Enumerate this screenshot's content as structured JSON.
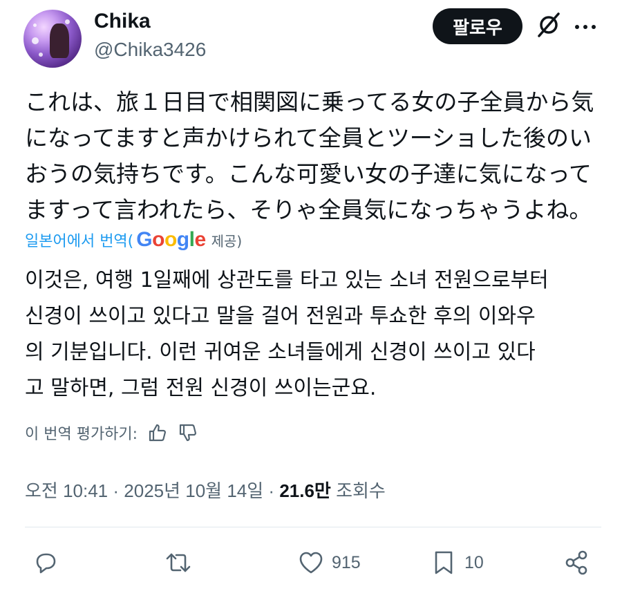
{
  "user": {
    "display_name": "Chika",
    "handle": "@Chika3426"
  },
  "header": {
    "follow_label": "팔로우"
  },
  "tweet": {
    "original_lines": [
      "これは、旅１日目で相関図に乗ってる女の子全員から気",
      "になってますと声かけられて全員とツーショした後のい",
      "おうの気持ちです。こんな可愛い女の子達に気になって",
      "ますって言われたら、そりゃ全員気になっちゃうよね。"
    ],
    "translated_by_prefix": "일본어에서 번역(",
    "translated_by_suffix": "제공)",
    "translated_lines": [
      "이것은, 여행 1일째에 상관도를 타고 있는 소녀 전원으로부터",
      "신경이 쓰이고 있다고 말을 걸어 전원과 투쇼한 후의 이와우",
      "의 기분입니다. 이런 귀여운 소녀들에게 신경이 쓰이고 있다",
      "고 말하면, 그럼 전원 신경이 쓰이는군요."
    ],
    "rate_label": "이 번역 평가하기:"
  },
  "meta": {
    "time": "오전 10:41",
    "date": "2025년 10월 14일",
    "views_count": "21.6만",
    "views_label": "조회수",
    "separator": "·"
  },
  "actions": {
    "likes": "915",
    "bookmarks": "10"
  },
  "colors": {
    "accent_blue": "#1d9bf0",
    "secondary_text": "#536471",
    "primary_text": "#0f1419",
    "follow_bg": "#0f1419"
  }
}
